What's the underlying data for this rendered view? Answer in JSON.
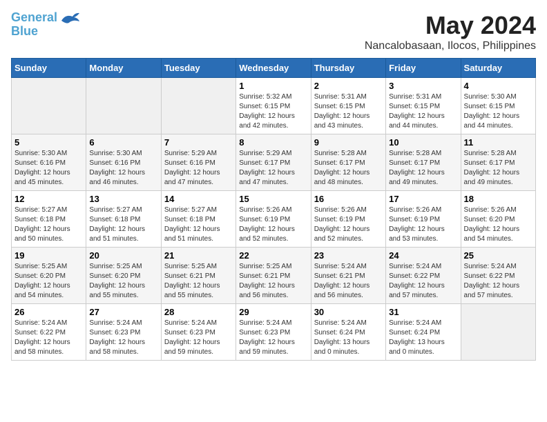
{
  "logo": {
    "line1": "General",
    "line2": "Blue",
    "bird_unicode": "🐦"
  },
  "title": "May 2024",
  "location": "Nancalobasaan, Ilocos, Philippines",
  "weekdays": [
    "Sunday",
    "Monday",
    "Tuesday",
    "Wednesday",
    "Thursday",
    "Friday",
    "Saturday"
  ],
  "weeks": [
    [
      {
        "day": "",
        "info": ""
      },
      {
        "day": "",
        "info": ""
      },
      {
        "day": "",
        "info": ""
      },
      {
        "day": "1",
        "info": "Sunrise: 5:32 AM\nSunset: 6:15 PM\nDaylight: 12 hours\nand 42 minutes."
      },
      {
        "day": "2",
        "info": "Sunrise: 5:31 AM\nSunset: 6:15 PM\nDaylight: 12 hours\nand 43 minutes."
      },
      {
        "day": "3",
        "info": "Sunrise: 5:31 AM\nSunset: 6:15 PM\nDaylight: 12 hours\nand 44 minutes."
      },
      {
        "day": "4",
        "info": "Sunrise: 5:30 AM\nSunset: 6:15 PM\nDaylight: 12 hours\nand 44 minutes."
      }
    ],
    [
      {
        "day": "5",
        "info": "Sunrise: 5:30 AM\nSunset: 6:16 PM\nDaylight: 12 hours\nand 45 minutes."
      },
      {
        "day": "6",
        "info": "Sunrise: 5:30 AM\nSunset: 6:16 PM\nDaylight: 12 hours\nand 46 minutes."
      },
      {
        "day": "7",
        "info": "Sunrise: 5:29 AM\nSunset: 6:16 PM\nDaylight: 12 hours\nand 47 minutes."
      },
      {
        "day": "8",
        "info": "Sunrise: 5:29 AM\nSunset: 6:17 PM\nDaylight: 12 hours\nand 47 minutes."
      },
      {
        "day": "9",
        "info": "Sunrise: 5:28 AM\nSunset: 6:17 PM\nDaylight: 12 hours\nand 48 minutes."
      },
      {
        "day": "10",
        "info": "Sunrise: 5:28 AM\nSunset: 6:17 PM\nDaylight: 12 hours\nand 49 minutes."
      },
      {
        "day": "11",
        "info": "Sunrise: 5:28 AM\nSunset: 6:17 PM\nDaylight: 12 hours\nand 49 minutes."
      }
    ],
    [
      {
        "day": "12",
        "info": "Sunrise: 5:27 AM\nSunset: 6:18 PM\nDaylight: 12 hours\nand 50 minutes."
      },
      {
        "day": "13",
        "info": "Sunrise: 5:27 AM\nSunset: 6:18 PM\nDaylight: 12 hours\nand 51 minutes."
      },
      {
        "day": "14",
        "info": "Sunrise: 5:27 AM\nSunset: 6:18 PM\nDaylight: 12 hours\nand 51 minutes."
      },
      {
        "day": "15",
        "info": "Sunrise: 5:26 AM\nSunset: 6:19 PM\nDaylight: 12 hours\nand 52 minutes."
      },
      {
        "day": "16",
        "info": "Sunrise: 5:26 AM\nSunset: 6:19 PM\nDaylight: 12 hours\nand 52 minutes."
      },
      {
        "day": "17",
        "info": "Sunrise: 5:26 AM\nSunset: 6:19 PM\nDaylight: 12 hours\nand 53 minutes."
      },
      {
        "day": "18",
        "info": "Sunrise: 5:26 AM\nSunset: 6:20 PM\nDaylight: 12 hours\nand 54 minutes."
      }
    ],
    [
      {
        "day": "19",
        "info": "Sunrise: 5:25 AM\nSunset: 6:20 PM\nDaylight: 12 hours\nand 54 minutes."
      },
      {
        "day": "20",
        "info": "Sunrise: 5:25 AM\nSunset: 6:20 PM\nDaylight: 12 hours\nand 55 minutes."
      },
      {
        "day": "21",
        "info": "Sunrise: 5:25 AM\nSunset: 6:21 PM\nDaylight: 12 hours\nand 55 minutes."
      },
      {
        "day": "22",
        "info": "Sunrise: 5:25 AM\nSunset: 6:21 PM\nDaylight: 12 hours\nand 56 minutes."
      },
      {
        "day": "23",
        "info": "Sunrise: 5:24 AM\nSunset: 6:21 PM\nDaylight: 12 hours\nand 56 minutes."
      },
      {
        "day": "24",
        "info": "Sunrise: 5:24 AM\nSunset: 6:22 PM\nDaylight: 12 hours\nand 57 minutes."
      },
      {
        "day": "25",
        "info": "Sunrise: 5:24 AM\nSunset: 6:22 PM\nDaylight: 12 hours\nand 57 minutes."
      }
    ],
    [
      {
        "day": "26",
        "info": "Sunrise: 5:24 AM\nSunset: 6:22 PM\nDaylight: 12 hours\nand 58 minutes."
      },
      {
        "day": "27",
        "info": "Sunrise: 5:24 AM\nSunset: 6:23 PM\nDaylight: 12 hours\nand 58 minutes."
      },
      {
        "day": "28",
        "info": "Sunrise: 5:24 AM\nSunset: 6:23 PM\nDaylight: 12 hours\nand 59 minutes."
      },
      {
        "day": "29",
        "info": "Sunrise: 5:24 AM\nSunset: 6:23 PM\nDaylight: 12 hours\nand 59 minutes."
      },
      {
        "day": "30",
        "info": "Sunrise: 5:24 AM\nSunset: 6:24 PM\nDaylight: 13 hours\nand 0 minutes."
      },
      {
        "day": "31",
        "info": "Sunrise: 5:24 AM\nSunset: 6:24 PM\nDaylight: 13 hours\nand 0 minutes."
      },
      {
        "day": "",
        "info": ""
      }
    ]
  ]
}
